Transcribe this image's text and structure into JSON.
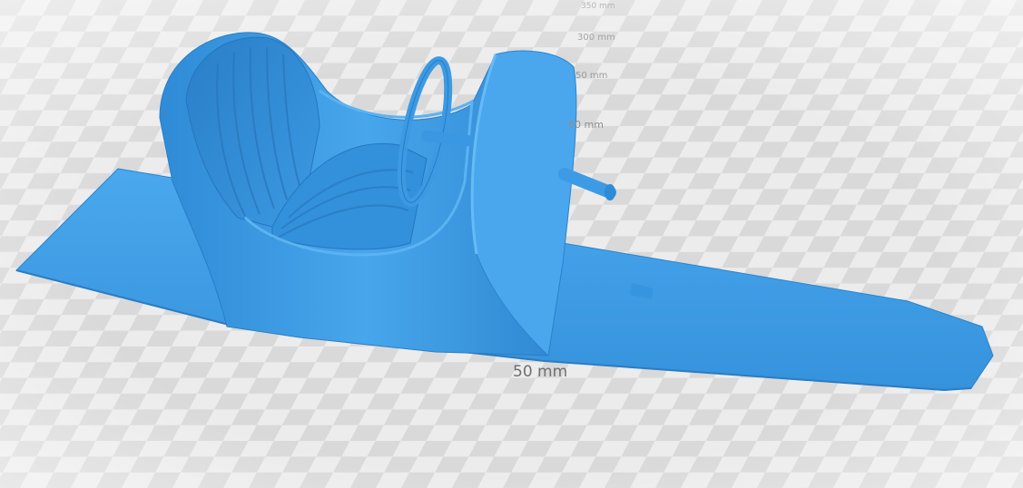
{
  "viewer": {
    "background_color": "#e9e9e9",
    "model_color": "#3d9de6",
    "checker_light": "#ececec",
    "checker_dark": "#d6d6d6"
  },
  "scale_labels": {
    "l350": "350 mm",
    "l300": "300 mm",
    "l250": "50 mm",
    "l200": "00 mm",
    "l50": "50 mm"
  }
}
